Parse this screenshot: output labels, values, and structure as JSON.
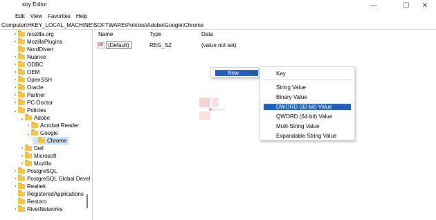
{
  "window": {
    "title": "stry Editor"
  },
  "menubar": [
    "Edit",
    "View",
    "Favorites",
    "Help"
  ],
  "address": "Computer\\HKEY_LOCAL_MACHINE\\SOFTWARE\\Policies\\Adobe\\Google\\Chrome",
  "tree": [
    {
      "label": "mozilla.org",
      "chev": "›"
    },
    {
      "label": "MozillaPlugins",
      "chev": "›"
    },
    {
      "label": "NordDivert",
      "chev": ""
    },
    {
      "label": "Nuance",
      "chev": "›"
    },
    {
      "label": "ODBC",
      "chev": "›"
    },
    {
      "label": "OEM",
      "chev": "›"
    },
    {
      "label": "OpenSSH",
      "chev": "›"
    },
    {
      "label": "Oracle",
      "chev": "›"
    },
    {
      "label": "Partner",
      "chev": "›"
    },
    {
      "label": "PC-Doctor",
      "chev": "›"
    },
    {
      "label": "Policies",
      "chev": "⌄"
    },
    {
      "label": "Adobe",
      "chev": "⌄"
    },
    {
      "label": "Acrobat Reader",
      "chev": "›"
    },
    {
      "label": "Google",
      "chev": "⌄"
    },
    {
      "label": "Chrome",
      "chev": ""
    },
    {
      "label": "Dell",
      "chev": "›"
    },
    {
      "label": "Microsoft",
      "chev": "›"
    },
    {
      "label": "Mozilla",
      "chev": "›"
    },
    {
      "label": "PostgreSQL",
      "chev": "›"
    },
    {
      "label": "PostgreSQL Global Devel",
      "chev": "›"
    },
    {
      "label": "Realtek",
      "chev": "›"
    },
    {
      "label": "RegisteredApplications",
      "chev": ""
    },
    {
      "label": "Restoro",
      "chev": ""
    },
    {
      "label": "RivetNetworks",
      "chev": "›"
    }
  ],
  "columns": {
    "name": "Name",
    "type": "Type",
    "data": "Data"
  },
  "values": [
    {
      "icon": "ab",
      "name": "(Default)",
      "type": "REG_SZ",
      "data": "(value not set)"
    }
  ],
  "context_menu": {
    "new_label": "New",
    "submenu": [
      "Key",
      "String Value",
      "Binary Value",
      "DWORD (32-bit) Value",
      "QWORD (64-bit) Value",
      "Multi-String Value",
      "Expandable String Value"
    ],
    "highlighted": "DWORD (32-bit) Value"
  },
  "watermark": {
    "text": "wccftech"
  },
  "icons": {
    "minimize": "minimize-icon",
    "maximize": "maximize-icon",
    "close": "close-icon",
    "folder": "folder-icon",
    "string-value": "string-value-icon"
  },
  "colors": {
    "highlight": "#1f5fbf",
    "folder": "#f4c542",
    "tree_selected": "#cde5f7"
  }
}
